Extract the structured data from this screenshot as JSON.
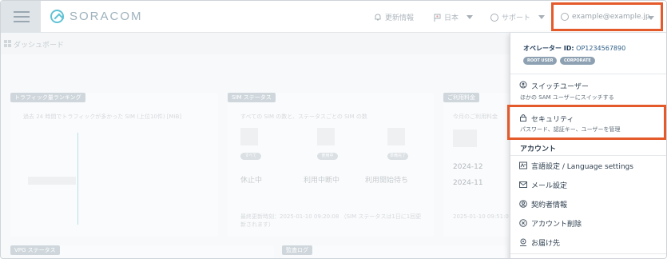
{
  "header": {
    "brand": "SORACOM",
    "updates": "更新情報",
    "language": "日本",
    "support": "サポート",
    "user_email": "example@example.jp"
  },
  "dashboard": {
    "breadcrumb": "ダッシュボード",
    "traffic_card": {
      "title": "トラフィック量ランキング",
      "caption": "過去 24 時間でトラフィックが多かった SIM (上位10件) [MiB]"
    },
    "sim_card": {
      "title": "SIM ステータス",
      "caption": "すべての SIM の数と、ステータスごとの SIM の数",
      "pills": [
        "すべて",
        "使用中",
        "準備完了"
      ],
      "statuses": [
        "休止中",
        "利用中断中",
        "利用開始待ち"
      ],
      "footnote": "最終更新時刻：2025-01-10 09:20:08 （SIM ステータスは1日に1回更新されます）"
    },
    "billing_card": {
      "title": "ご利用料金",
      "caption": "今月のご利用料金",
      "months": [
        "2024-12",
        "2024-11"
      ],
      "footnote": "2025-01-10 09:51:01 時点"
    },
    "vpg_card": {
      "title": "VPG ステータス"
    },
    "audit_card": {
      "title": "監査ログ"
    }
  },
  "dropdown": {
    "operator_label": "オペレーター ID:",
    "operator_id": "OP1234567890",
    "badges": [
      "ROOT USER",
      "CORPORATE"
    ],
    "switch_user": {
      "title": "スイッチユーザー",
      "sub": "ほかの SAM ユーザーにスイッチする"
    },
    "security": {
      "title": "セキュリティ",
      "sub": "パスワード、認証キー、ユーザーを管理"
    },
    "account_section": "アカウント",
    "items": [
      {
        "label": "言語設定 / Language settings",
        "icon": "translate-icon"
      },
      {
        "label": "メール設定",
        "icon": "mail-icon"
      },
      {
        "label": "契約者情報",
        "icon": "contract-icon"
      },
      {
        "label": "アカウント削除",
        "icon": "delete-account-icon"
      },
      {
        "label": "お届け先",
        "icon": "shipping-icon"
      }
    ]
  },
  "colors": {
    "highlight": "#e55a2a",
    "brand": "#60c3d6"
  }
}
